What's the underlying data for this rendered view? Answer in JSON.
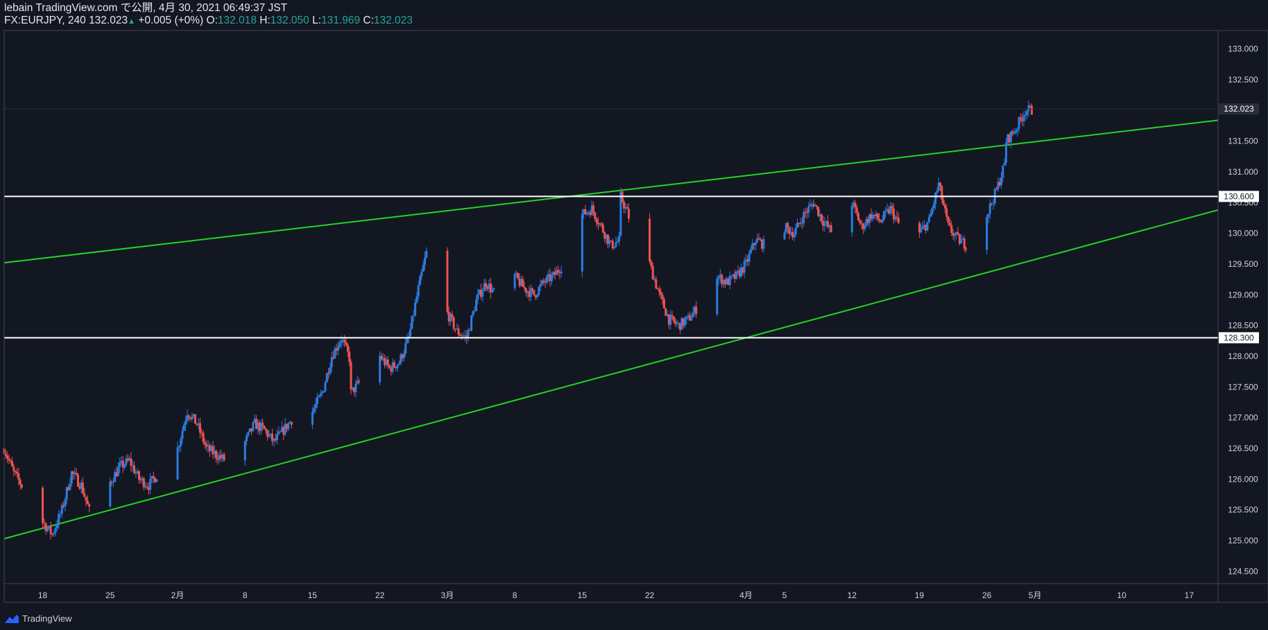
{
  "header": {
    "line1": "lebain TradingView.com で公開, 4月 30, 2021 06:49:37 JST",
    "symbol": "FX:EURJPY, 240",
    "last": "132.023",
    "change_arrow": "▲",
    "change": "+0.005 (+0%)",
    "o_label": "O:",
    "o_value": "132.018",
    "h_label": "H:",
    "h_value": "132.050",
    "l_label": "L:",
    "l_value": "131.969",
    "c_label": "C:",
    "c_value": "132.023"
  },
  "footer": {
    "brand": "TradingView"
  },
  "colors": {
    "background": "#131722",
    "bull": "#2a7de1",
    "bear": "#ef5350",
    "trendline": "#22d422",
    "hline": "#ffffff",
    "axis_text": "#d1d4dc"
  },
  "chart_data": {
    "type": "candlestick",
    "title": "FX:EURJPY, 240",
    "ylim": [
      124.3,
      133.3
    ],
    "y_ticks": [
      "124.500",
      "125.000",
      "125.500",
      "126.000",
      "126.500",
      "127.000",
      "127.500",
      "128.000",
      "128.500",
      "129.000",
      "129.500",
      "130.000",
      "130.500",
      "131.000",
      "131.500",
      "132.000",
      "132.500",
      "133.000"
    ],
    "x_ticks": [
      "18",
      "25",
      "2月",
      "8",
      "15",
      "22",
      "3月",
      "8",
      "15",
      "22",
      "4月",
      "5",
      "12",
      "19",
      "26",
      "5月",
      "10",
      "17"
    ],
    "price_label": "132.023",
    "hlines": [
      {
        "value": 130.6,
        "label": "130.600"
      },
      {
        "value": 128.3,
        "label": "128.300"
      }
    ],
    "trendlines": [
      {
        "from": [
          "2021-01-14",
          129.52
        ],
        "to": [
          "2021-05-20",
          131.84
        ]
      },
      {
        "from": [
          "2021-01-14",
          125.03
        ],
        "to": [
          "2021-05-20",
          130.38
        ]
      }
    ],
    "series_path": [
      [
        "2021-01-14",
        126.5
      ],
      [
        "2021-01-15",
        126.1
      ],
      [
        "2021-01-17",
        125.6
      ],
      [
        "2021-01-18",
        125.3
      ],
      [
        "2021-01-19",
        125.1
      ],
      [
        "2021-01-20",
        125.5
      ],
      [
        "2021-01-21",
        126.1
      ],
      [
        "2021-01-22",
        125.9
      ],
      [
        "2021-01-23",
        125.4
      ],
      [
        "2021-01-24",
        125.7
      ],
      [
        "2021-01-26",
        126.2
      ],
      [
        "2021-01-27",
        126.3
      ],
      [
        "2021-01-28",
        126.0
      ],
      [
        "2021-01-29",
        125.9
      ],
      [
        "2021-01-30",
        126.1
      ],
      [
        "2021-01-31",
        126.0
      ],
      [
        "2021-02-01",
        126.5
      ],
      [
        "2021-02-02",
        127.1
      ],
      [
        "2021-02-03",
        126.9
      ],
      [
        "2021-02-04",
        126.5
      ],
      [
        "2021-02-05",
        126.4
      ],
      [
        "2021-02-06",
        126.3
      ],
      [
        "2021-02-07",
        126.2
      ],
      [
        "2021-02-08",
        126.6
      ],
      [
        "2021-02-09",
        126.9
      ],
      [
        "2021-02-10",
        126.8
      ],
      [
        "2021-02-11",
        126.6
      ],
      [
        "2021-02-12",
        126.8
      ],
      [
        "2021-02-13",
        127.0
      ],
      [
        "2021-02-14",
        126.9
      ],
      [
        "2021-02-15",
        127.1
      ],
      [
        "2021-02-16",
        127.4
      ],
      [
        "2021-02-17",
        128.0
      ],
      [
        "2021-02-18",
        128.3
      ],
      [
        "2021-02-19",
        127.9
      ],
      [
        "2021-02-19",
        127.4
      ],
      [
        "2021-02-20",
        127.6
      ],
      [
        "2021-02-21",
        127.9
      ],
      [
        "2021-02-22",
        128.0
      ],
      [
        "2021-02-23",
        127.8
      ],
      [
        "2021-02-24",
        127.9
      ],
      [
        "2021-02-25",
        128.3
      ],
      [
        "2021-02-26",
        129.1
      ],
      [
        "2021-02-27",
        129.8
      ],
      [
        "2021-02-28",
        129.1
      ],
      [
        "2021-03-01",
        128.7
      ],
      [
        "2021-03-02",
        128.4
      ],
      [
        "2021-03-03",
        128.3
      ],
      [
        "2021-03-04",
        128.9
      ],
      [
        "2021-03-05",
        129.2
      ],
      [
        "2021-03-06",
        129.0
      ],
      [
        "2021-03-07",
        129.1
      ],
      [
        "2021-03-08",
        129.3
      ],
      [
        "2021-03-09",
        129.1
      ],
      [
        "2021-03-10",
        129.0
      ],
      [
        "2021-03-11",
        129.2
      ],
      [
        "2021-03-12",
        129.3
      ],
      [
        "2021-03-13",
        129.5
      ],
      [
        "2021-03-14",
        130.0
      ],
      [
        "2021-03-15",
        130.3
      ],
      [
        "2021-03-16",
        130.4
      ],
      [
        "2021-03-17",
        130.1
      ],
      [
        "2021-03-18",
        129.8
      ],
      [
        "2021-03-19",
        129.9
      ],
      [
        "2021-03-19",
        130.6
      ],
      [
        "2021-03-20",
        130.2
      ],
      [
        "2021-03-21",
        129.7
      ],
      [
        "2021-03-22",
        129.5
      ],
      [
        "2021-03-23",
        129.0
      ],
      [
        "2021-03-24",
        128.6
      ],
      [
        "2021-03-25",
        128.5
      ],
      [
        "2021-03-26",
        128.6
      ],
      [
        "2021-03-27",
        128.8
      ],
      [
        "2021-03-28",
        128.5
      ],
      [
        "2021-03-29",
        129.3
      ],
      [
        "2021-03-30",
        129.2
      ],
      [
        "2021-03-31",
        129.3
      ],
      [
        "2021-04-01",
        129.5
      ],
      [
        "2021-04-02",
        129.9
      ],
      [
        "2021-04-03",
        129.8
      ],
      [
        "2021-04-04",
        130.2
      ],
      [
        "2021-04-05",
        130.1
      ],
      [
        "2021-04-06",
        130.0
      ],
      [
        "2021-04-07",
        130.3
      ],
      [
        "2021-04-08",
        130.5
      ],
      [
        "2021-04-09",
        130.2
      ],
      [
        "2021-04-10",
        130.0
      ],
      [
        "2021-04-11",
        130.3
      ],
      [
        "2021-04-12",
        130.5
      ],
      [
        "2021-04-13",
        130.1
      ],
      [
        "2021-04-14",
        130.3
      ],
      [
        "2021-04-15",
        130.2
      ],
      [
        "2021-04-16",
        130.4
      ],
      [
        "2021-04-17",
        130.1
      ],
      [
        "2021-04-18",
        130.3
      ],
      [
        "2021-04-19",
        130.0
      ],
      [
        "2021-04-20",
        130.2
      ],
      [
        "2021-04-21",
        130.8
      ],
      [
        "2021-04-22",
        130.1
      ],
      [
        "2021-04-23",
        129.9
      ],
      [
        "2021-04-24",
        129.8
      ],
      [
        "2021-04-25",
        129.7
      ],
      [
        "2021-04-26",
        130.3
      ],
      [
        "2021-04-27",
        130.7
      ],
      [
        "2021-04-28",
        131.2
      ],
      [
        "2021-04-28",
        131.5
      ],
      [
        "2021-04-29",
        131.7
      ],
      [
        "2021-04-30",
        132.0
      ]
    ]
  }
}
